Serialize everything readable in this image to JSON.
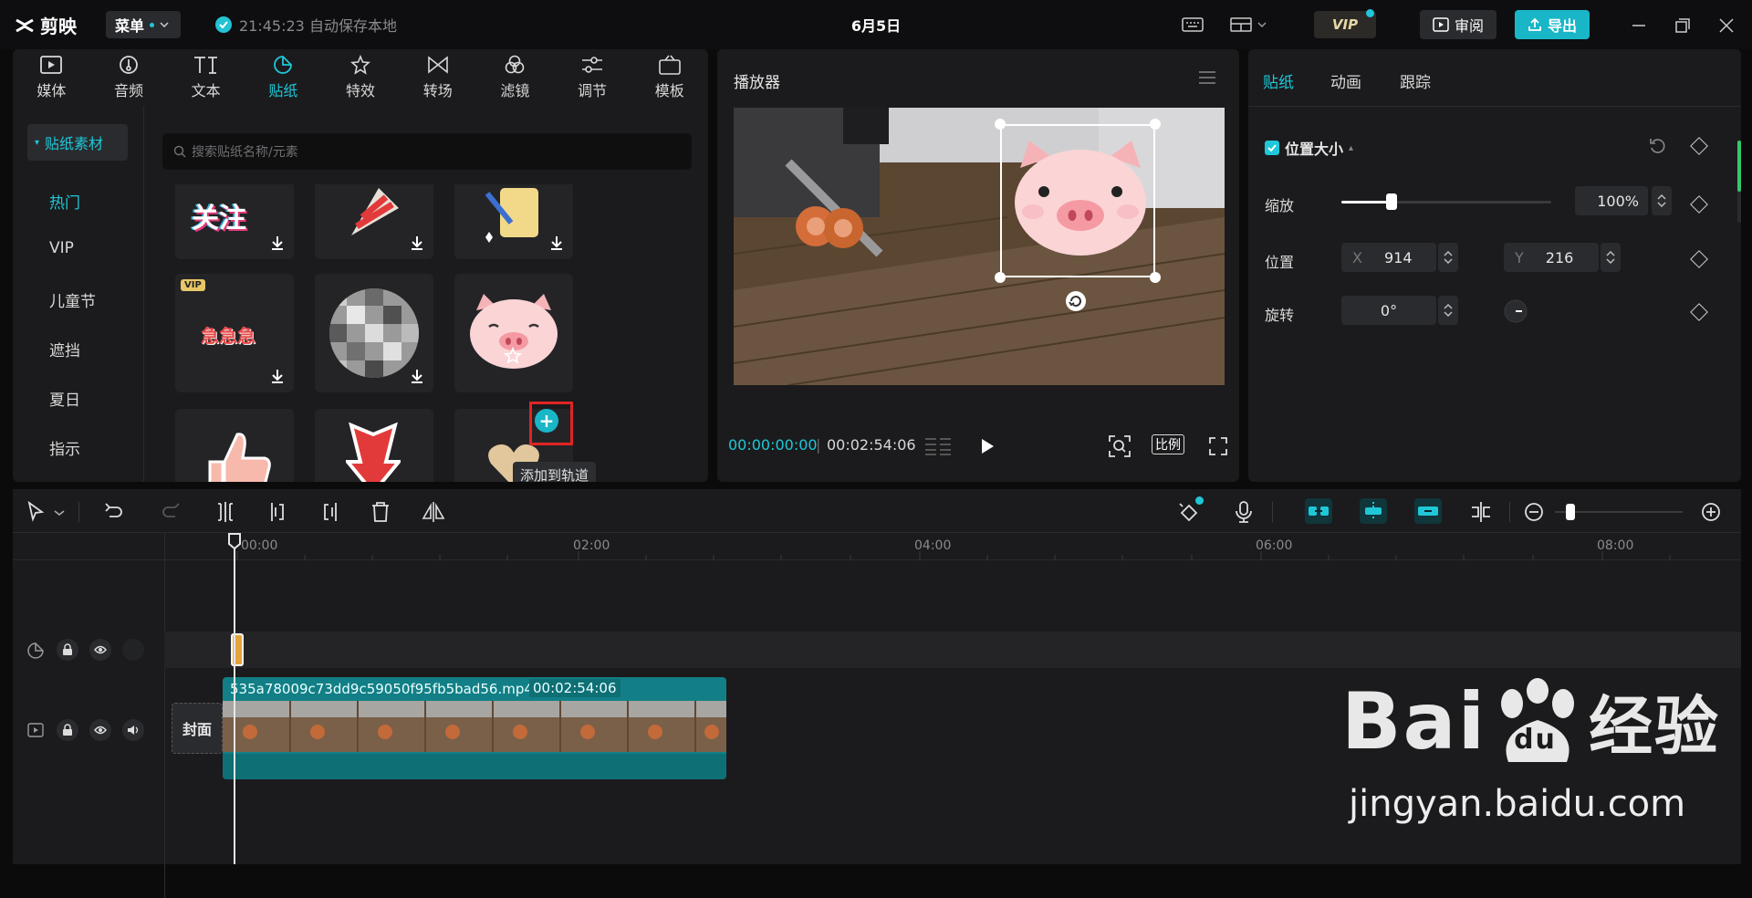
{
  "app": {
    "logo_text": "剪映",
    "menu_label": "菜单",
    "save_status": "21:45:23 自动保存本地",
    "project_title": "6月5日",
    "vip_label": "VIP",
    "review_label": "审阅",
    "export_label": "导出"
  },
  "media": {
    "tabs": [
      {
        "label": "媒体",
        "icon": "media-icon"
      },
      {
        "label": "音频",
        "icon": "audio-icon"
      },
      {
        "label": "文本",
        "icon": "text-icon"
      },
      {
        "label": "贴纸",
        "icon": "sticker-icon"
      },
      {
        "label": "特效",
        "icon": "effects-icon"
      },
      {
        "label": "转场",
        "icon": "transition-icon"
      },
      {
        "label": "滤镜",
        "icon": "filter-icon"
      },
      {
        "label": "调节",
        "icon": "adjust-icon"
      },
      {
        "label": "模板",
        "icon": "template-icon"
      }
    ],
    "active_tab": "贴纸",
    "category_header": "贴纸素材",
    "categories": [
      "热门",
      "VIP",
      "儿童节",
      "遮挡",
      "夏日",
      "指示"
    ],
    "active_category": "热门",
    "search_placeholder": "搜索贴纸名称/元素",
    "sticker_top_text": "关注",
    "sticker_vip_badge": "VIP",
    "sticker_anxious_text": "急急急",
    "add_tooltip": "添加到轨道"
  },
  "player": {
    "title": "播放器",
    "current_time": "00:00:00:00",
    "duration": "00:02:54:06",
    "ratio_label": "比例"
  },
  "props": {
    "tabs": [
      "贴纸",
      "动画",
      "跟踪"
    ],
    "active_tab": "贴纸",
    "section": "位置大小",
    "scale_label": "缩放",
    "scale_value": "100%",
    "scale_fraction": 0.24,
    "position_label": "位置",
    "x_label": "X",
    "x_value": "914",
    "y_label": "Y",
    "y_value": "216",
    "rotate_label": "旋转",
    "rotate_value": "0°"
  },
  "timeline": {
    "ruler_labels": [
      "00:00",
      "02:00",
      "04:00",
      "06:00",
      "08:00"
    ],
    "clip_name": "535a78009c73dd9c59050f95fb5bad56.mp4",
    "clip_duration": "00:02:54:06",
    "cover_label": "封面"
  },
  "watermark": {
    "brand_left": "Bai",
    "brand_du": "du",
    "brand_cn": "经验",
    "url": "jingyan.baidu.com"
  },
  "colors": {
    "accent": "#1fc7d8",
    "export": "#19b6c8",
    "highlight": "#e02424",
    "clip": "#127f86"
  }
}
